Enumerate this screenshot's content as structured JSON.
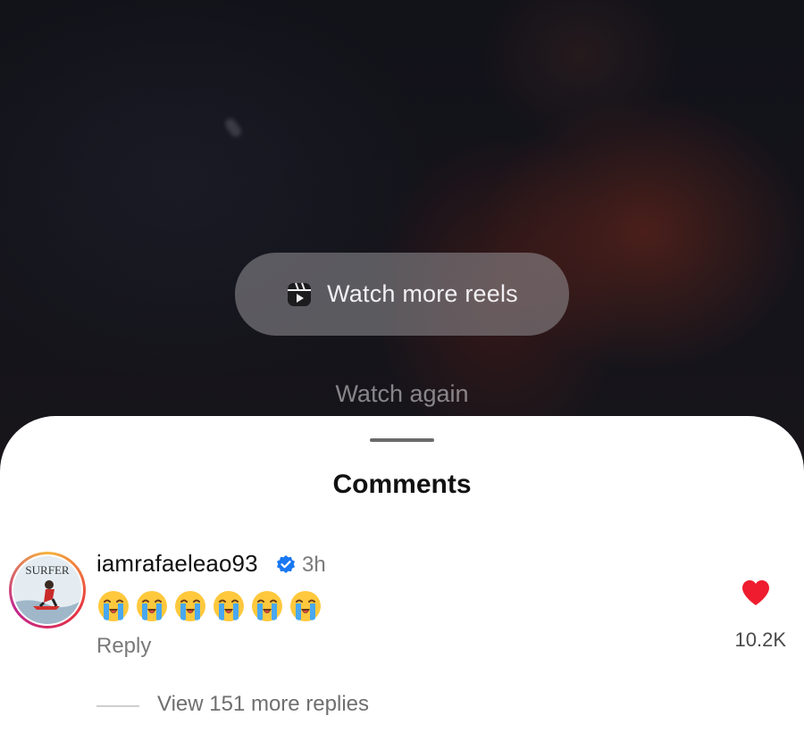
{
  "video": {
    "watch_more_label": "Watch more reels",
    "watch_again_label": "Watch again",
    "icons": {
      "reels": "reels-icon"
    }
  },
  "comments_sheet": {
    "title": "Comments",
    "comment": {
      "avatar_text": "SURFER",
      "username": "iamrafaeleao93",
      "verified": true,
      "timestamp": "3h",
      "emoji_text": "😭😭😭😭😭😭",
      "emoji_count": 6,
      "reply_label": "Reply",
      "like_count": "10.2K",
      "liked": true,
      "view_replies_label": "View 151 more replies"
    },
    "colors": {
      "verified": "#1877f2",
      "heart": "#ee1c2e",
      "story_ring": [
        "#f5b43d",
        "#e8343f",
        "#c1258d"
      ]
    }
  }
}
